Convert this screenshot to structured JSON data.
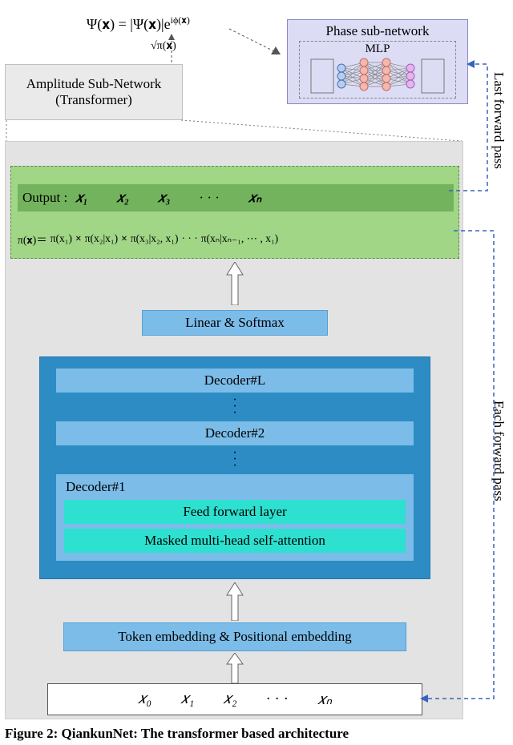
{
  "top_equation": "Ψ(𝐱) = |Ψ(𝐱)|e",
  "top_equation_exp": "iϕ(𝐱)",
  "sqrt_label": "√π(𝐱)",
  "amplitude_box": {
    "line1": "Amplitude Sub-Network",
    "line2": "(Transformer)"
  },
  "phase_box": {
    "title": "Phase sub-network",
    "mlp": "MLP"
  },
  "output": {
    "label": "Output :",
    "items": [
      "𝑥₁",
      "𝑥₂",
      "𝑥₃",
      "· · ·",
      "𝑥ₙ"
    ]
  },
  "pi_line": {
    "lhs": "π(𝐱)＝",
    "terms": [
      "π(x₁)",
      "×",
      "π(x₂|x₁)",
      "×",
      "π(x₃|x₂, x₁)",
      " · · · ",
      "π(xₙ|xₙ₋₁, ⋯ , x₁)"
    ]
  },
  "linear_softmax": "Linear & Softmax",
  "decoders": {
    "top": "Decoder#L",
    "mid": "Decoder#2",
    "d1": "Decoder#1",
    "ff": "Feed forward layer",
    "attn": "Masked multi-head self-attention"
  },
  "embedding": "Token embedding & Positional embedding",
  "input_row": [
    "𝑥₀",
    "𝑥₁",
    "𝑥₂",
    "· · ·",
    "𝑥ₙ"
  ],
  "side": {
    "last": "Last forward pass",
    "each": "Each forward pass"
  },
  "caption_bold": "Figure 2: QiankunNet: The transformer based architecture"
}
